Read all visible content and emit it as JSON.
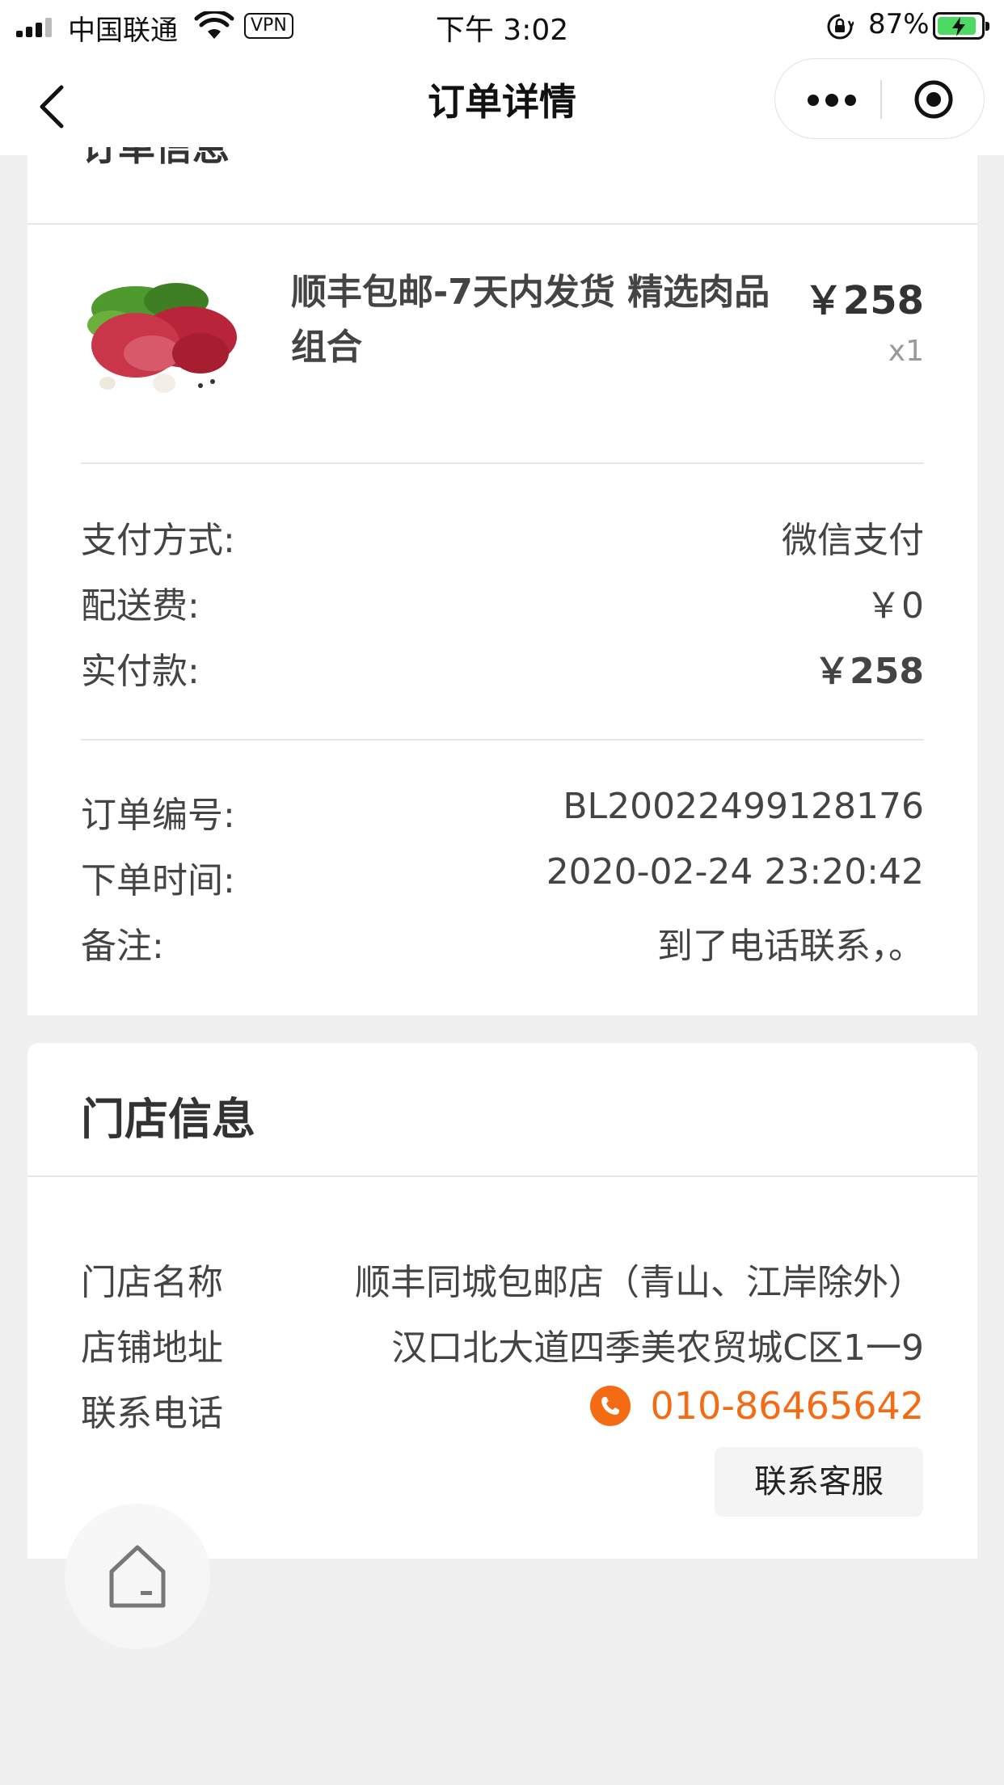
{
  "status_bar": {
    "carrier": "中国联通",
    "vpn": "VPN",
    "time": "下午 3:02",
    "battery": "87%"
  },
  "nav": {
    "title": "订单详情"
  },
  "order_section": {
    "title": "订单信息",
    "product": {
      "title": "顺丰包邮-7天内发货 精选肉品组合",
      "price": "￥258",
      "qty": "x1"
    },
    "payment": {
      "method_label": "支付方式:",
      "method_value": "微信支付",
      "delivery_label": "配送费:",
      "delivery_value": "￥0",
      "paid_label": "实付款:",
      "paid_value": "￥258"
    },
    "info": {
      "order_no_label": "订单编号:",
      "order_no_value": "BL20022499128176",
      "order_time_label": "下单时间:",
      "order_time_value": "2020-02-24 23:20:42",
      "remark_label": "备注:",
      "remark_value": "到了电话联系，。"
    }
  },
  "store_section": {
    "title": "门店信息",
    "name_label": "门店名称",
    "name_value": "顺丰同城包邮店（青山、江岸除外）",
    "address_label": "店铺地址",
    "address_value": "汉口北大道四季美农贸城C区1一9",
    "phone_label": "联系电话",
    "phone_value": "010-86465642",
    "service_button": "联系客服"
  },
  "colors": {
    "accent": "#f56b14",
    "battery": "#4cd964",
    "background": "#f0f0f0"
  }
}
